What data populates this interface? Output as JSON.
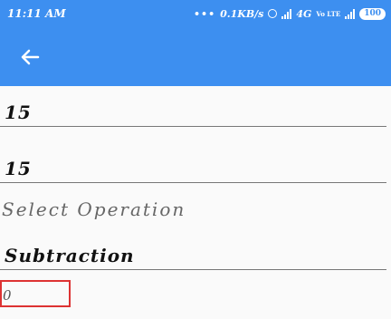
{
  "status_bar": {
    "time": "11:11 AM",
    "more": "•••",
    "network_speed": "0.1KB/s",
    "network_type": "4G",
    "volte_label": "Vo LTE",
    "battery": "100"
  },
  "app_bar": {
    "back_icon": "arrow-left-icon",
    "color": "#3d8ff0"
  },
  "form": {
    "first_number": "15",
    "second_number": "15",
    "operation_label": "Select Operation",
    "operation_value": "Subtraction",
    "result": "0",
    "result_border_color": "#dd3333"
  }
}
